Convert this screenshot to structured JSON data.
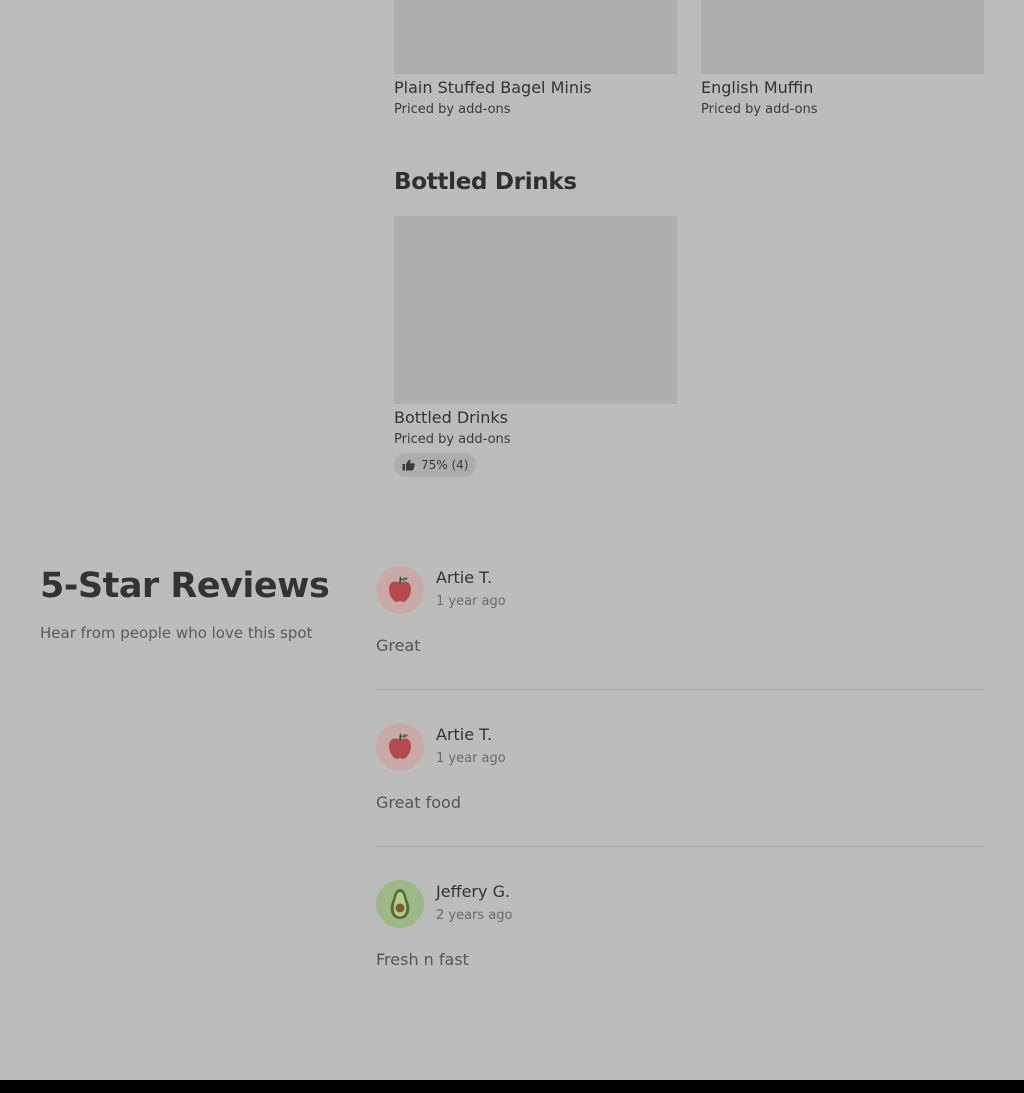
{
  "menu": {
    "top_items": [
      {
        "name": "Plain Stuffed Bagel Minis",
        "price": "Priced by add-ons"
      },
      {
        "name": "English Muffin",
        "price": "Priced by add-ons"
      }
    ],
    "section": {
      "title": "Bottled Drinks",
      "items": [
        {
          "name": "Bottled Drinks",
          "price": "Priced by add-ons",
          "rating": "75% (4)"
        }
      ]
    }
  },
  "reviews": {
    "title": "5-Star Reviews",
    "subtitle": "Hear from people who love this spot",
    "list": [
      {
        "name": "Artie T.",
        "age": "1 year ago",
        "text": "Great",
        "avatar_icon": "apple-icon",
        "avatar_bg": "#c9a8a8"
      },
      {
        "name": "Artie T.",
        "age": "1 year ago",
        "text": "Great food",
        "avatar_icon": "apple-icon",
        "avatar_bg": "#c9a8a8"
      },
      {
        "name": "Jeffery G.",
        "age": "2 years ago",
        "text": "Fresh n fast",
        "avatar_icon": "avocado-icon",
        "avatar_bg": "#9fb887"
      }
    ]
  }
}
